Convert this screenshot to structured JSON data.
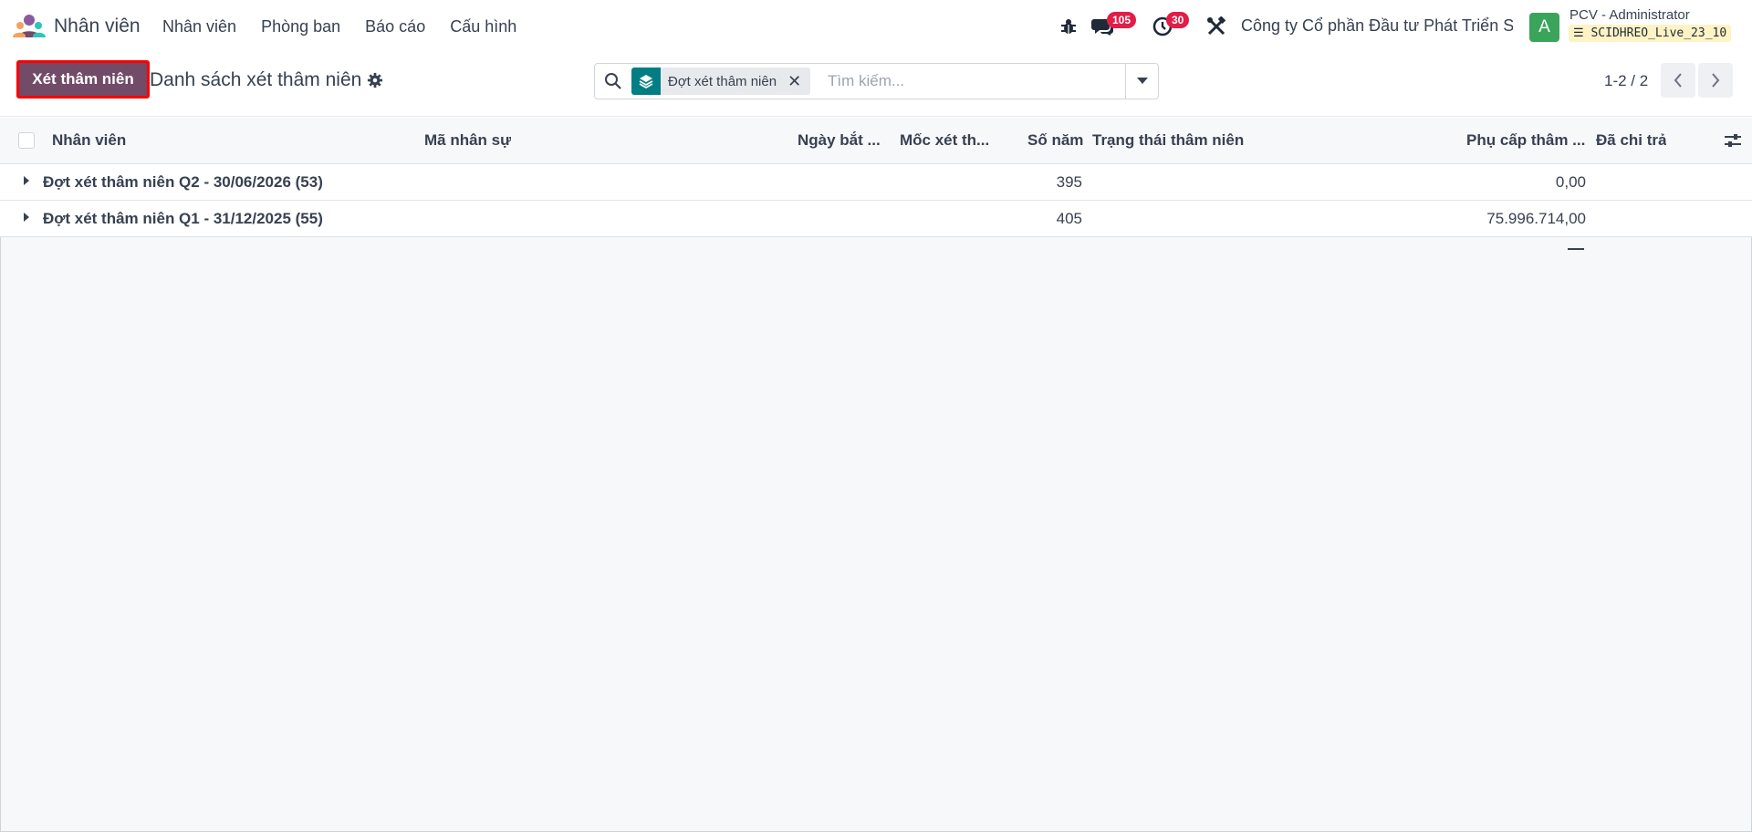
{
  "navbar": {
    "app_name": "Nhân viên",
    "menu": [
      {
        "label": "Nhân viên"
      },
      {
        "label": "Phòng ban"
      },
      {
        "label": "Báo cáo"
      },
      {
        "label": "Cấu hình"
      }
    ],
    "icons": [
      "bug-icon",
      "chat-icon",
      "clock-icon",
      "tools-icon"
    ],
    "messages_badge": "105",
    "activities_badge": "30",
    "company": "Công ty Cổ phần Đầu tư Phát Triển S...",
    "avatar_letter": "A",
    "user_name": "PCV - Administrator",
    "database": "SCIDHREO_Live_23_10"
  },
  "control_panel": {
    "primary_button": "Xét thâm niên",
    "breadcrumb": "Danh sách xét thâm niên",
    "search": {
      "facet_label": "Đợt xét thâm niên",
      "facet_close": "✕",
      "placeholder": "Tìm kiếm..."
    },
    "pager": "1-2 / 2"
  },
  "list": {
    "columns": [
      "Nhân viên",
      "Mã nhân sự",
      "Ngày bắt ...",
      "Mốc xét th...",
      "Số năm",
      "Trạng thái thâm niên",
      "Phụ cấp thâm ...",
      "Đã chi trả"
    ],
    "groups": [
      {
        "name": "Đợt xét thâm niên Q2 - 30/06/2026 (53)",
        "so_nam": "395",
        "phu_cap": "0,00"
      },
      {
        "name": "Đợt xét thâm niên Q1 - 31/12/2025 (55)",
        "so_nam": "405",
        "phu_cap": "75.996.714,00"
      }
    ]
  },
  "colors": {
    "primary": "#714b67",
    "highlight_border": "#ff0000",
    "facet": "#017e84",
    "badge": "#e11d48",
    "avatar": "#3aa45b"
  }
}
